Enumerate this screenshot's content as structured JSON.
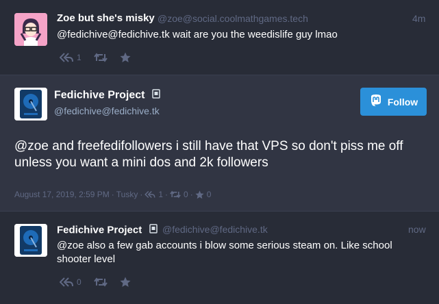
{
  "statuses": [
    {
      "display_name": "Zoe but she's misky",
      "handle": "@zoe@social.coolmathgames.tech",
      "time": "4m",
      "content": "@fedichive@fedichive.tk wait are you the weedislife guy lmao",
      "reply_count": "1",
      "boost_count": "",
      "fav_count": ""
    }
  ],
  "detailed": {
    "display_name": "Fedichive Project",
    "handle": "@fedichive@fedichive.tk",
    "follow_label": "Follow",
    "content": "@zoe and freefedifollowers i still have that VPS so don't piss me off unless you want a mini dos and 2k followers",
    "date": "August 17, 2019, 2:59 PM",
    "application": "Tusky",
    "separator": "·",
    "reply_count": "1",
    "boost_count": "0",
    "fav_count": "0"
  },
  "reply": {
    "display_name": "Fedichive Project",
    "handle": "@fedichive@fedichive.tk",
    "time": "now",
    "content": "@zoe also a few gab accounts i blow some serious steam on. Like school shooter level",
    "reply_count": "0"
  },
  "icons": {
    "reply": "reply-all-icon",
    "boost": "retweet-icon",
    "favourite": "star-icon",
    "bot": "robot-icon",
    "follow": "mastodon-logo-icon"
  },
  "colors": {
    "background": "#282c37",
    "focused_background": "#313543",
    "muted": "#606984",
    "accent": "#2b90d9",
    "text": "#ffffff"
  }
}
